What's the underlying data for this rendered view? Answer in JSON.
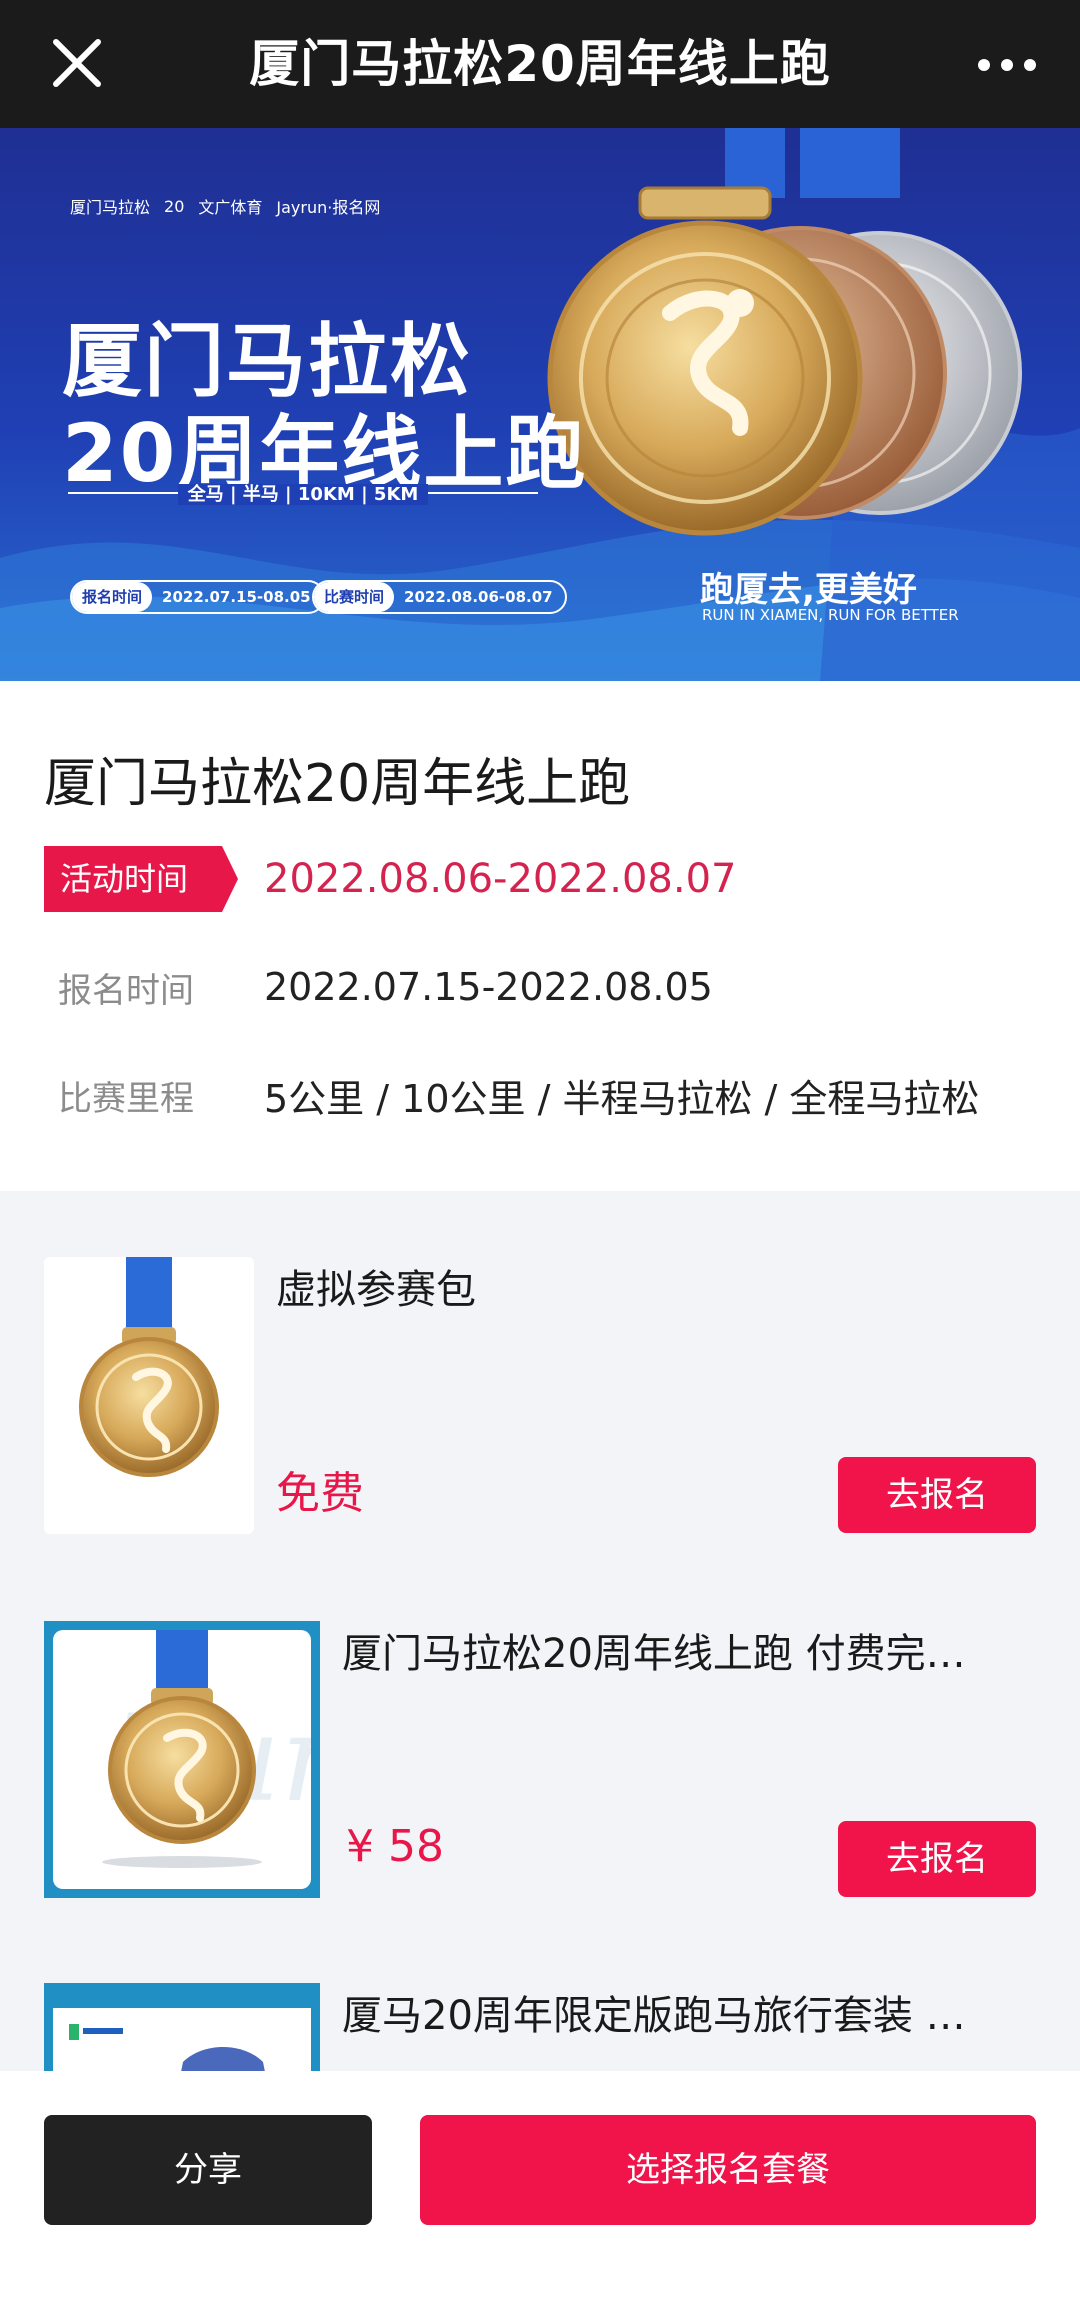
{
  "topbar": {
    "title": "厦门马拉松20周年线上跑",
    "close_icon": "close-icon",
    "more_icon": "more-dots-icon"
  },
  "banner": {
    "logos": [
      "厦门马拉松",
      "20",
      "文广体育",
      "Jayrun·报名网"
    ],
    "headline_line1": "厦门马拉松",
    "headline_line2": "20周年线上跑",
    "distances": "全马 | 半马 | 10KM | 5KM",
    "reg_tag": "报名时间",
    "reg_value": "2022.07.15-08.05",
    "race_tag": "比赛时间",
    "race_value": "2022.08.06-08.07",
    "slogan": "跑厦去,更美好",
    "slogan_en": "RUN IN XIAMEN, RUN FOR BETTER"
  },
  "info": {
    "event_title": "厦门马拉松20周年线上跑",
    "activity_label": "活动时间",
    "activity_value": "2022.08.06-2022.08.07",
    "registration_label": "报名时间",
    "registration_value": "2022.07.15-2022.08.05",
    "distance_label": "比赛里程",
    "distance_value": "5公里 / 10公里 / 半程马拉松 / 全程马拉松"
  },
  "packages": [
    {
      "name": "虚拟参赛包",
      "price": "免费",
      "button": "去报名"
    },
    {
      "name": "厦门马拉松20周年线上跑 付费完…",
      "price": "¥ 58",
      "button": "去报名"
    },
    {
      "name": "厦马20周年限定版跑马旅行套装 …",
      "price": "",
      "button": ""
    }
  ],
  "bottom": {
    "share_label": "分享",
    "choose_label": "选择报名套餐"
  },
  "colors": {
    "accent_red": "#f0144b",
    "dark": "#1b1b1b",
    "banner_blue": "#1f40b4"
  }
}
